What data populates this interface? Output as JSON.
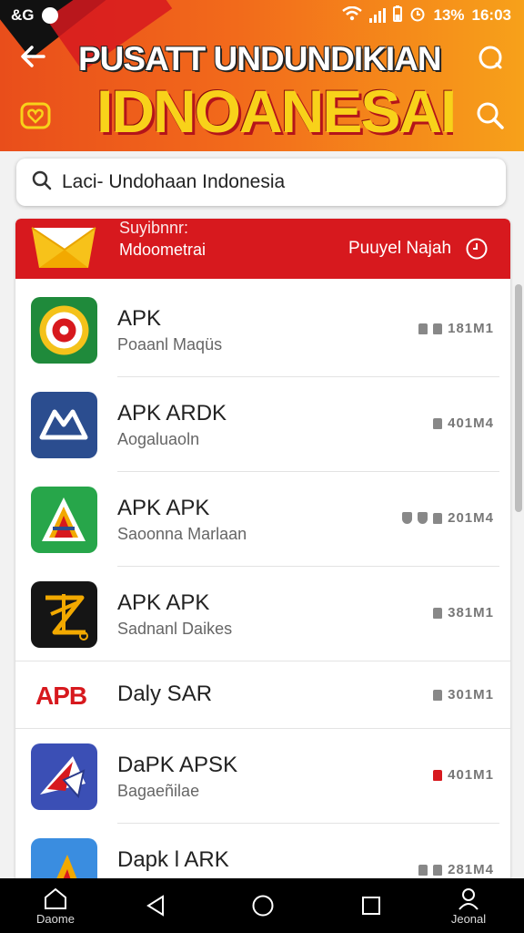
{
  "status_bar": {
    "left_text": "&G",
    "battery": "13%",
    "time": "16:03"
  },
  "header": {
    "title_line1": "PUSATT UNDUNDIKIAN",
    "title_line2": "IDNOANESAI",
    "colors": {
      "banner_start": "#e94e1b",
      "banner_end": "#f7a11a",
      "title2": "#f8d21a"
    }
  },
  "search": {
    "value": "Laci- Undohaan Indonesia",
    "icon": "search-icon"
  },
  "promo": {
    "line1": "Suyibnnr:",
    "line2": "Mdoometrai",
    "right_label": "Puuyel Najah",
    "color": "#d7191e"
  },
  "apps": [
    {
      "name": "APK",
      "sub": "Poaanl Maqüs",
      "meta": "181M1",
      "lock_icons": 2
    },
    {
      "name": "APK ARDK",
      "sub": "Aogaluaoln",
      "meta": "401M4",
      "lock_icons": 1
    },
    {
      "name": "APK APK",
      "sub": "Saoonna Marlaan",
      "meta": "201M4",
      "lock_icons": 2
    },
    {
      "name": "APK APK",
      "sub": "Sadnanl Daikes",
      "meta": "381M1",
      "lock_icons": 1
    },
    {
      "name": "Daly SAR",
      "sub": "",
      "meta": "301M1",
      "logo_text": "APB",
      "lock_icons": 1
    },
    {
      "name": "DaPK APSK",
      "sub": "Bagaeñilae",
      "meta": "401M1",
      "lock_icons": 1
    },
    {
      "name": "Dapk l ARK",
      "sub": "",
      "meta": "281M4",
      "lock_icons": 2
    }
  ],
  "nav": {
    "left_label": "Daome",
    "right_label": "Jeonal"
  }
}
